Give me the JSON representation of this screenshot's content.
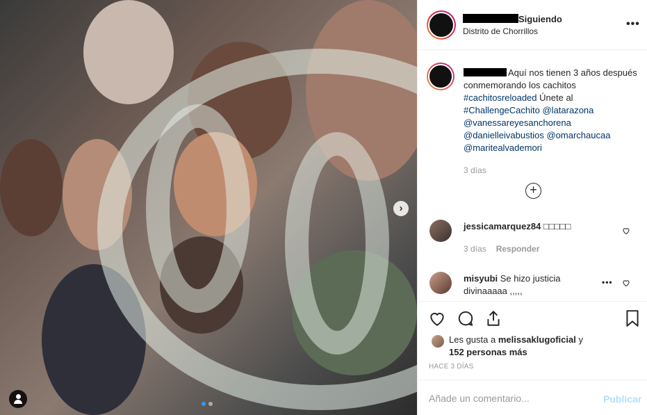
{
  "post": {
    "header": {
      "follow_status": "Siguiendo",
      "location": "Distrito de Chorrillos",
      "more_icon": "more-horizontal-icon"
    },
    "caption": {
      "text_before": "Aquí nos tienen 3 años después conmemorando los cachitos ",
      "hashtag1": "#cachitosreloaded",
      "text_mid": " Únete al ",
      "hashtag2": "#ChallengeCachito",
      "mention1": "@latarazona",
      "mention2": "@vanessareyesanchorena",
      "mention3": "@danielleivabustios",
      "mention4": "@omarchaucaa",
      "mention5": "@maritealvademori",
      "time": "3 días"
    },
    "comments": [
      {
        "user": "jessicamarquez84",
        "text": "□□□□□",
        "time": "3 días",
        "reply": "Responder"
      },
      {
        "user": "misyubi",
        "text": "Se hizo justicia divinaaaaa ,,,,,",
        "time": "",
        "reply": ""
      }
    ],
    "likes": {
      "prefix": "Les gusta a ",
      "user": "melissaklugoficial",
      "conj": " y",
      "others": "152 personas más"
    },
    "post_time": "HACE 3 DÍAS",
    "comment_input": {
      "placeholder": "Añade un comentario..."
    },
    "publish_label": "Publicar",
    "accent_color": "#3897f0"
  }
}
